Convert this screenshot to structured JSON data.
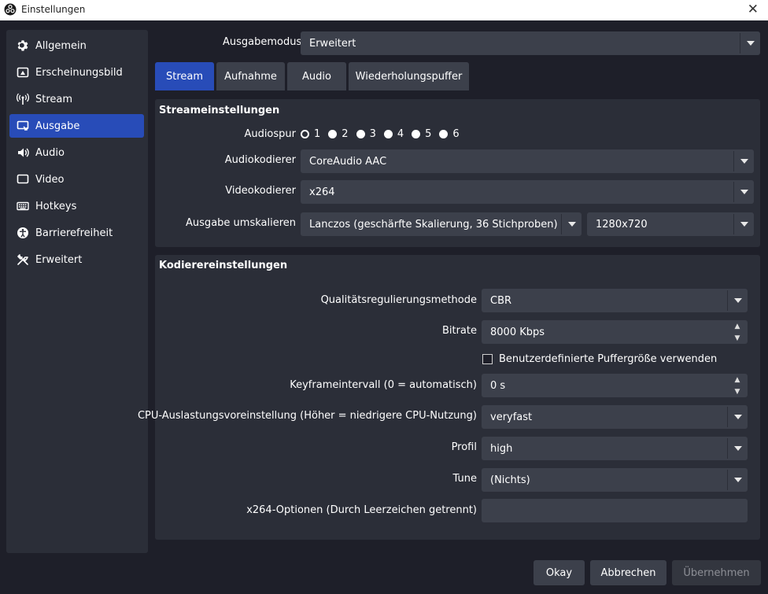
{
  "window": {
    "title": "Einstellungen",
    "close_glyph": "✕"
  },
  "sidebar": {
    "items": [
      {
        "label": "Allgemein",
        "icon": "gear-icon"
      },
      {
        "label": "Erscheinungsbild",
        "icon": "appearance-icon"
      },
      {
        "label": "Stream",
        "icon": "antenna-icon"
      },
      {
        "label": "Ausgabe",
        "icon": "output-icon",
        "active": true
      },
      {
        "label": "Audio",
        "icon": "speaker-icon"
      },
      {
        "label": "Video",
        "icon": "monitor-icon"
      },
      {
        "label": "Hotkeys",
        "icon": "keyboard-icon"
      },
      {
        "label": "Barrierefreiheit",
        "icon": "accessibility-icon"
      },
      {
        "label": "Erweitert",
        "icon": "tools-icon"
      }
    ]
  },
  "output_mode": {
    "label": "Ausgabemodus",
    "value": "Erweitert"
  },
  "tabs": [
    {
      "label": "Stream",
      "active": true
    },
    {
      "label": "Aufnahme"
    },
    {
      "label": "Audio"
    },
    {
      "label": "Wiederholungspuffer"
    }
  ],
  "stream_settings": {
    "title": "Streameinstellungen",
    "audio_track": {
      "label": "Audiospur",
      "options": [
        "1",
        "2",
        "3",
        "4",
        "5",
        "6"
      ],
      "selected": "1"
    },
    "audio_encoder": {
      "label": "Audiokodierer",
      "value": "CoreAudio AAC"
    },
    "video_encoder": {
      "label": "Videokodierer",
      "value": "x264"
    },
    "rescale": {
      "label": "Ausgabe umskalieren",
      "method": "Lanczos (geschärfte Skalierung, 36 Stichproben)",
      "resolution": "1280x720"
    }
  },
  "encoder_settings": {
    "title": "Kodierereinstellungen",
    "rate_control": {
      "label": "Qualitätsregulierungsmethode",
      "value": "CBR"
    },
    "bitrate": {
      "label": "Bitrate",
      "value": "8000 Kbps"
    },
    "custom_buffer": {
      "label": "Benutzerdefinierte Puffergröße verwenden",
      "checked": false
    },
    "keyframe": {
      "label": "Keyframeintervall (0 = automatisch)",
      "value": "0 s"
    },
    "cpu_preset": {
      "label": "CPU-Auslastungsvoreinstellung (Höher = niedrigere CPU-Nutzung)",
      "value": "veryfast"
    },
    "profile": {
      "label": "Profil",
      "value": "high"
    },
    "tune": {
      "label": "Tune",
      "value": "(Nichts)"
    },
    "x264_options": {
      "label": "x264-Optionen (Durch Leerzeichen getrennt)",
      "value": ""
    }
  },
  "footer": {
    "ok": "Okay",
    "cancel": "Abbrechen",
    "apply": "Übernehmen"
  },
  "colors": {
    "accent": "#284cb8",
    "background": "#1e1f29",
    "panel": "#2b2e38",
    "control": "#3c404b"
  }
}
